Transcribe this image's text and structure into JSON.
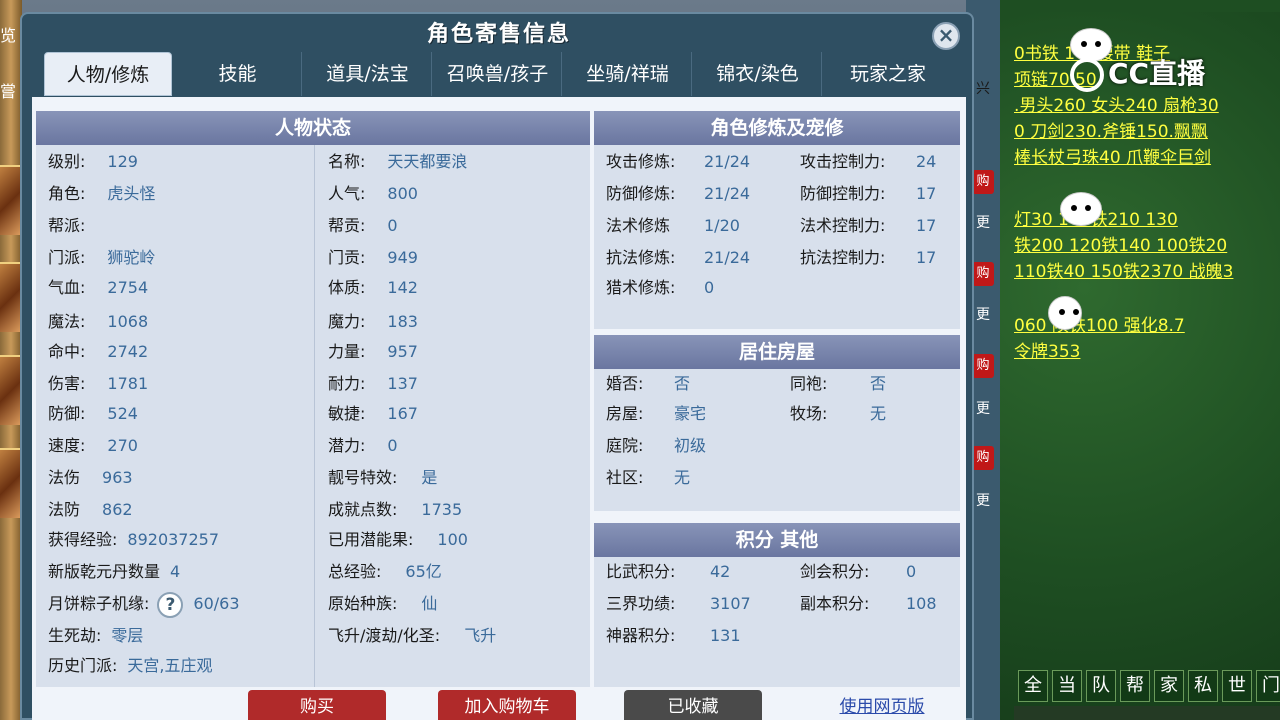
{
  "window": {
    "title": "角色寄售信息",
    "close_label": "×"
  },
  "tabs": [
    "人物/修炼",
    "技能",
    "道具/法宝",
    "召唤兽/孩子",
    "坐骑/祥瑞",
    "锦衣/染色",
    "玩家之家"
  ],
  "panels": {
    "status_title": "人物状态",
    "cultivation_title": "角色修炼及宠修",
    "house_title": "居住房屋",
    "points_title": "积分 其他"
  },
  "status_left": [
    {
      "label": "级别:",
      "value": "129"
    },
    {
      "label": "角色:",
      "value": "虎头怪"
    },
    {
      "label": "帮派:",
      "value": ""
    },
    {
      "label": "门派:",
      "value": "狮驼岭"
    },
    {
      "label": "气血:",
      "value": "2754"
    },
    {
      "label": "魔法:",
      "value": "1068"
    },
    {
      "label": "命中:",
      "value": "2742"
    },
    {
      "label": "伤害:",
      "value": "1781"
    },
    {
      "label": "防御:",
      "value": "524"
    },
    {
      "label": "速度:",
      "value": "270"
    },
    {
      "label": "法伤",
      "value": "963"
    },
    {
      "label": "法防",
      "value": "862"
    },
    {
      "label": "获得经验:",
      "value": "892037257"
    },
    {
      "label": "新版乾元丹数量",
      "value": "4"
    },
    {
      "label": "月饼粽子机缘:",
      "value": "60/63"
    },
    {
      "label": "生死劫:",
      "value": "零层"
    },
    {
      "label": "历史门派:",
      "value": "天宫,五庄观"
    }
  ],
  "status_right": [
    {
      "label": "名称:",
      "value": "天天都要浪"
    },
    {
      "label": "人气:",
      "value": "800"
    },
    {
      "label": "帮贡:",
      "value": "0"
    },
    {
      "label": "门贡:",
      "value": "949"
    },
    {
      "label": "体质:",
      "value": "142"
    },
    {
      "label": "魔力:",
      "value": "183"
    },
    {
      "label": "力量:",
      "value": "957"
    },
    {
      "label": "耐力:",
      "value": "137"
    },
    {
      "label": "敏捷:",
      "value": "167"
    },
    {
      "label": "潜力:",
      "value": "0"
    },
    {
      "label": "靓号特效:",
      "value": "是"
    },
    {
      "label": "成就点数:",
      "value": "1735"
    },
    {
      "label": "已用潜能果:",
      "value": "100"
    },
    {
      "label": "总经验:",
      "value": "65亿"
    },
    {
      "label": "原始种族:",
      "value": "仙"
    },
    {
      "label": "飞升/渡劫/化圣:",
      "value": "飞升"
    }
  ],
  "help_icon": "?",
  "cultivation": [
    {
      "label": "攻击修炼:",
      "value": "21/24",
      "label2": "攻击控制力:",
      "value2": "24"
    },
    {
      "label": "防御修炼:",
      "value": "21/24",
      "label2": "防御控制力:",
      "value2": "17"
    },
    {
      "label": "法术修炼",
      "value": "1/20",
      "label2": "法术控制力:",
      "value2": "17"
    },
    {
      "label": "抗法修炼:",
      "value": "21/24",
      "label2": "抗法控制力:",
      "value2": "17"
    },
    {
      "label": "猎术修炼:",
      "value": "0",
      "label2": "",
      "value2": ""
    }
  ],
  "house": [
    {
      "label": "婚否:",
      "value": "否",
      "label2": "同袍:",
      "value2": "否"
    },
    {
      "label": "房屋:",
      "value": "豪宅",
      "label2": "牧场:",
      "value2": "无"
    },
    {
      "label": "庭院:",
      "value": "初级",
      "label2": "",
      "value2": ""
    },
    {
      "label": "社区:",
      "value": "无",
      "label2": "",
      "value2": ""
    }
  ],
  "points": [
    {
      "label": "比武积分:",
      "value": "42",
      "label2": "剑会积分:",
      "value2": "0"
    },
    {
      "label": "三界功绩:",
      "value": "3107",
      "label2": "副本积分:",
      "value2": "108"
    },
    {
      "label": "神器积分:",
      "value": "131",
      "label2": "",
      "value2": ""
    }
  ],
  "buttons": {
    "buy": "购买",
    "add_cart": "加入购物车",
    "favorited": "已收藏",
    "web_version": "使用网页版"
  },
  "edge_tabs": [
    "购",
    "更",
    "购",
    "更",
    "购",
    "更",
    "购",
    "更"
  ],
  "left_top_text": "览",
  "left_mid_text": "嘗",
  "right_edge_text": "兴",
  "chat": {
    "watermark": "CC直播",
    "lines": [
      "0书铁      100腰带 鞋子",
      "项链70              50",
      ".男头260 女头240 扇枪30",
      "0 刀剑230.斧锤150.飘飘",
      "棒长杖弓珠40 爪鞭伞巨剑",
      "灯30         140铁210 130",
      "铁200 120铁140 100铁20",
      "110铁40 150铁2370 战魄3",
      "060      陨铁100 强化8.7",
      "令牌353"
    ],
    "channels": [
      "全",
      "当",
      "队",
      "帮",
      "家",
      "私",
      "世",
      "门"
    ]
  },
  "colors": {
    "panel_head": "#7680a8",
    "value_text": "#3a6a9a",
    "chat_text": "#ffff40",
    "chat_bg": "#1e4e22"
  }
}
